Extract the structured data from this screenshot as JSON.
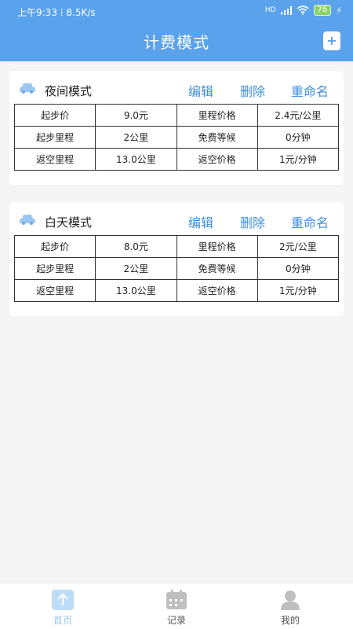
{
  "status_bar": {
    "time": "上午9:33",
    "speed": "8.5K/s",
    "signal": "HD",
    "battery": "76"
  },
  "header": {
    "title": "计费模式",
    "add_icon": "add-file-icon"
  },
  "actions": {
    "edit": "编辑",
    "delete": "删除",
    "rename": "重命名"
  },
  "modes": [
    {
      "name": "夜间模式",
      "rows": [
        [
          "起步价",
          "9.0元",
          "里程价格",
          "2.4元/公里"
        ],
        [
          "起步里程",
          "2公里",
          "免费等候",
          "0分钟"
        ],
        [
          "返空里程",
          "13.0公里",
          "返空价格",
          "1元/分钟"
        ]
      ]
    },
    {
      "name": "白天模式",
      "rows": [
        [
          "起步价",
          "8.0元",
          "里程价格",
          "2元/公里"
        ],
        [
          "起步里程",
          "2公里",
          "免费等候",
          "0分钟"
        ],
        [
          "返空里程",
          "13.0公里",
          "返空价格",
          "1元/分钟"
        ]
      ]
    }
  ],
  "tabbar": {
    "home": "首页",
    "records": "记录",
    "mine": "我的"
  },
  "colors": {
    "primary": "#5aa2ec",
    "action": "#3e8fe0",
    "tab_active": "#9fc8f3"
  }
}
